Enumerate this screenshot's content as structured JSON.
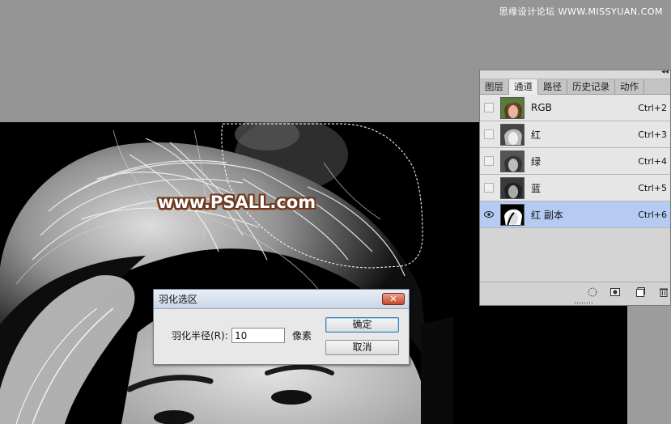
{
  "watermark": "思缘设计论坛  WWW.MISSYUAN.COM",
  "canvas_watermark": "www.PSALL.com",
  "panel": {
    "tabs": [
      "图层",
      "通道",
      "路径",
      "历史记录",
      "动作"
    ],
    "active_tab": "通道",
    "channels": [
      {
        "name": "RGB",
        "shortcut": "Ctrl+2",
        "visible": false,
        "selected": false
      },
      {
        "name": "红",
        "shortcut": "Ctrl+3",
        "visible": false,
        "selected": false
      },
      {
        "name": "绿",
        "shortcut": "Ctrl+4",
        "visible": false,
        "selected": false
      },
      {
        "name": "蓝",
        "shortcut": "Ctrl+5",
        "visible": false,
        "selected": false
      },
      {
        "name": "红 副本",
        "shortcut": "Ctrl+6",
        "visible": true,
        "selected": true
      }
    ],
    "footer_icons": [
      "load-selection-icon",
      "save-selection-icon",
      "new-channel-icon",
      "delete-channel-icon"
    ]
  },
  "dialog": {
    "title": "羽化选区",
    "close_label": "✕",
    "field_label": "羽化半径(R):",
    "field_value": "10",
    "unit": "像素",
    "ok_label": "确定",
    "cancel_label": "取消"
  },
  "colors": {
    "selected_row": "#b5cbf2",
    "watermark_outline": "#6b3a20"
  }
}
